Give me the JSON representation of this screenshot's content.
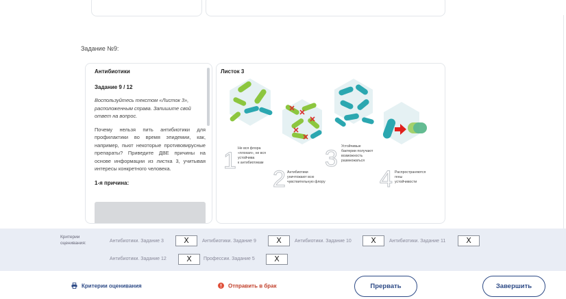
{
  "task": {
    "title": "Задание №9:"
  },
  "text_card": {
    "heading": "Антибиотики",
    "subheading": "Задание 9 / 12",
    "instruction": "Воспользуйтесь текстом «Листок 3», расположенным справа. Запишите свой ответ на вопрос.",
    "question": "Почему нельзя пить антибиотики для профилактики во время эпидемии, как, например, пьют некоторые противовирусные препараты? Приведите ДВЕ причины на основе информации из листка 3, учитывая интересы конкретного человека.",
    "reason_label": "1-я причина:",
    "answer_value": ""
  },
  "image_card": {
    "title": "Листок 3",
    "steps": [
      {
        "number": "1",
        "caption": [
          "Не вся флора",
          "«плохая», не вся",
          "устойчива",
          "к антибиотикам"
        ]
      },
      {
        "number": "2",
        "caption": [
          "Антибиотики",
          "уничтожают всю",
          "чувствительную флору"
        ]
      },
      {
        "number": "3",
        "caption": [
          "Устойчивые",
          "бактерии получают",
          "возможность",
          "размножаться"
        ]
      },
      {
        "number": "4",
        "caption": [
          "Распространяются",
          "гены",
          "устойчивости"
        ]
      }
    ],
    "colors": {
      "hexagon": "#e5f1f3",
      "green": "#8cc63f",
      "teal": "#2ba7b0",
      "cross": "#d9322f",
      "arrow": "#e0201c"
    }
  },
  "criteria": {
    "label": "Критерии оценивания:",
    "items": [
      {
        "name": "Антибиотики. Задание 3",
        "mark": "X"
      },
      {
        "name": "Антибиотики. Задание 9",
        "mark": "X"
      },
      {
        "name": "Антибиотики. Задание 10",
        "mark": "X"
      },
      {
        "name": "Антибиотики. Задание 11",
        "mark": "X"
      },
      {
        "name": "Антибиотики. Задание 12",
        "mark": "X"
      },
      {
        "name": "Профессии. Задание 5",
        "mark": "X"
      }
    ]
  },
  "footer": {
    "criteria_link": "Критерии оценивания",
    "report_link": "Отправить в брак",
    "abort_button": "Прервать",
    "finish_button": "Завершить",
    "icons": {
      "criteria": "print-icon",
      "report": "alert-icon"
    },
    "colors": {
      "accent": "#2d4a86",
      "danger": "#c2412c"
    }
  }
}
